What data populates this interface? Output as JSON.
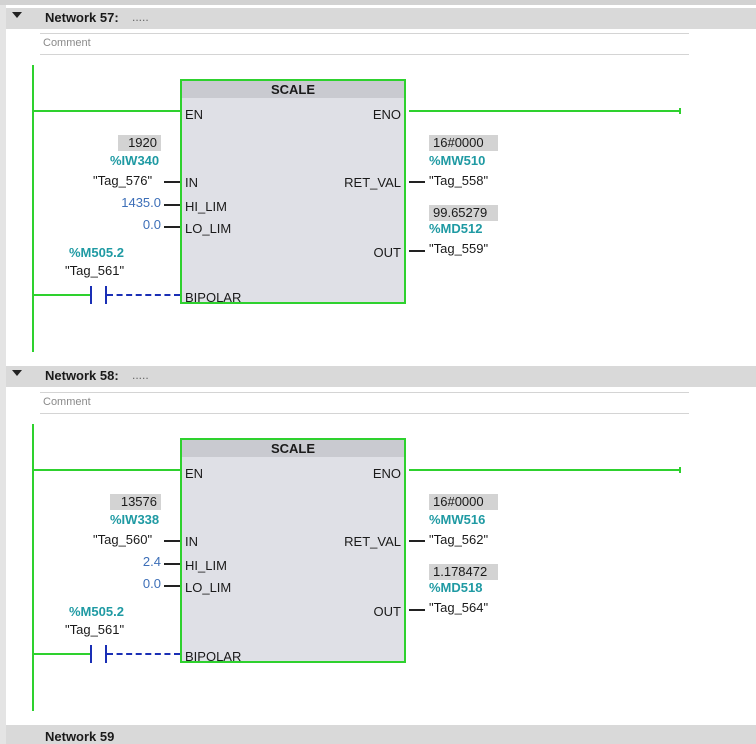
{
  "networks": [
    {
      "title": "Network 57:",
      "dots": ".....",
      "comment": "Comment",
      "block": {
        "name": "SCALE",
        "pins": {
          "en": "EN",
          "eno": "ENO",
          "in": "IN",
          "hi_lim": "HI_LIM",
          "lo_lim": "LO_LIM",
          "bipolar": "BIPOLAR",
          "ret_val": "RET_VAL",
          "out": "OUT"
        },
        "in_value": "1920",
        "in_addr": "%IW340",
        "in_tag": "\"Tag_576\"",
        "hi_lim": "1435.0",
        "lo_lim": "0.0",
        "bipolar_addr": "%M505.2",
        "bipolar_tag": "\"Tag_561\"",
        "ret_value": "16#0000",
        "ret_addr": "%MW510",
        "ret_tag": "\"Tag_558\"",
        "out_value": "99.65279",
        "out_addr": "%MD512",
        "out_tag": "\"Tag_559\""
      }
    },
    {
      "title": "Network 58:",
      "dots": ".....",
      "comment": "Comment",
      "block": {
        "name": "SCALE",
        "pins": {
          "en": "EN",
          "eno": "ENO",
          "in": "IN",
          "hi_lim": "HI_LIM",
          "lo_lim": "LO_LIM",
          "bipolar": "BIPOLAR",
          "ret_val": "RET_VAL",
          "out": "OUT"
        },
        "in_value": "13576",
        "in_addr": "%IW338",
        "in_tag": "\"Tag_560\"",
        "hi_lim": "2.4",
        "lo_lim": "0.0",
        "bipolar_addr": "%M505.2",
        "bipolar_tag": "\"Tag_561\"",
        "ret_value": "16#0000",
        "ret_addr": "%MW516",
        "ret_tag": "\"Tag_562\"",
        "out_value": "1.178472",
        "out_addr": "%MD518",
        "out_tag": "\"Tag_564\""
      }
    }
  ],
  "next_network_partial": "Network 59",
  "colors": {
    "power_flow": "#2ed12e",
    "address": "#1f9aa3",
    "constant": "#3d6fb8",
    "contact": "#1a2fb5",
    "block_fill": "#dfe0e6"
  }
}
